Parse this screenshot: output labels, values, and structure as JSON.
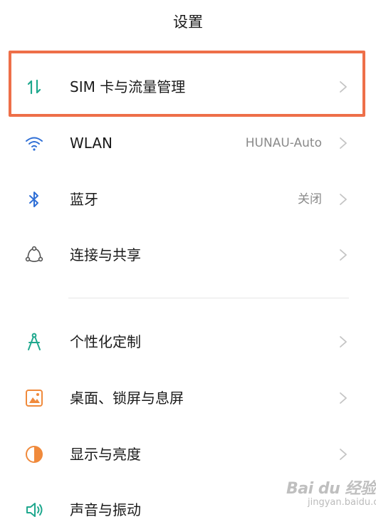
{
  "header": {
    "title": "设置"
  },
  "colors": {
    "highlight_border": "#ee6f49",
    "icon_teal": "#1fa88e",
    "icon_blue": "#2f6fd6",
    "icon_orange": "#f08a3c"
  },
  "settings": {
    "items": [
      {
        "label": "SIM 卡与流量管理",
        "value": "",
        "icon": "sim-data-arrows-icon"
      },
      {
        "label": "WLAN",
        "value": "HUNAU-Auto",
        "icon": "wifi-icon"
      },
      {
        "label": "蓝牙",
        "value": "关闭",
        "icon": "bluetooth-icon"
      },
      {
        "label": "连接与共享",
        "value": "",
        "icon": "connection-share-icon"
      },
      {
        "label": "个性化定制",
        "value": "",
        "icon": "compass-personalize-icon"
      },
      {
        "label": "桌面、锁屏与息屏",
        "value": "",
        "icon": "wallpaper-icon"
      },
      {
        "label": "显示与亮度",
        "value": "",
        "icon": "brightness-icon"
      },
      {
        "label": "声音与振动",
        "value": "",
        "icon": "speaker-icon"
      }
    ]
  },
  "watermark": {
    "text": "Bai du 经验",
    "sub": "jingyan.baidu.com"
  }
}
